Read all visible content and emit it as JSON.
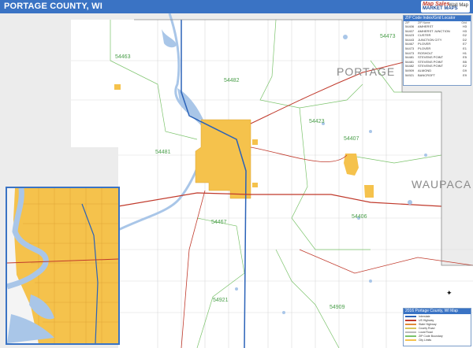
{
  "header": {
    "title": "PORTAGE COUNTY, WI",
    "brand_line1": "Map Sales",
    "brand_line2": "MARKET MAPS",
    "brand_line3": "Wall Map"
  },
  "county_labels": {
    "portage": "PORTAGE",
    "waupaca": "WAUPACA"
  },
  "zip_labels": [
    "54473",
    "54463",
    "54482",
    "54423",
    "54481",
    "54407",
    "54467",
    "54406",
    "54921",
    "54909",
    "54481"
  ],
  "zip_index": {
    "title": "ZIP Code Index/Grid Locator",
    "col_zip": "ZIP",
    "col_name": "ZIP Name",
    "col_grid": "Grid",
    "rows": [
      {
        "zip": "54406",
        "name": "AMHERST",
        "grid": "H3"
      },
      {
        "zip": "54407",
        "name": "AMHERST JUNCTION",
        "grid": "H3"
      },
      {
        "zip": "54423",
        "name": "CUSTER",
        "grid": "G2"
      },
      {
        "zip": "54443",
        "name": "JUNCTION CITY",
        "grid": "D2"
      },
      {
        "zip": "54467",
        "name": "PLOVER",
        "grid": "E7"
      },
      {
        "zip": "54473",
        "name": "PLOVER",
        "grid": "E1"
      },
      {
        "zip": "54473",
        "name": "ROSHOLT",
        "grid": "H1"
      },
      {
        "zip": "54481",
        "name": "STEVENS POINT",
        "grid": "E5"
      },
      {
        "zip": "54481",
        "name": "STEVENS POINT",
        "grid": "B5"
      },
      {
        "zip": "54482",
        "name": "STEVENS POINT",
        "grid": "E2"
      },
      {
        "zip": "54909",
        "name": "ALMOND",
        "grid": "G9"
      },
      {
        "zip": "54921",
        "name": "BANCROFT",
        "grid": "E9"
      }
    ]
  },
  "legend": {
    "title": "2016 Portage County, WI Map",
    "rows": [
      "Interstate",
      "US Highway",
      "State Highway",
      "County Road",
      "Local Road",
      "ZIP Code Boundary",
      "City Limits"
    ],
    "colors": [
      "#2a62b8",
      "#c0392b",
      "#e08a3a",
      "#d8c45a",
      "#bbbbbb",
      "#7bc36b",
      "#f5c24c"
    ]
  },
  "compass": {
    "label": "N"
  },
  "colors": {
    "title_bar": "#3a73c4",
    "water": "#a9c6e8",
    "city": "#f5c24c",
    "zip_line": "#7bc36b",
    "highway": "#c0392b",
    "outside_county": "#ececec"
  }
}
